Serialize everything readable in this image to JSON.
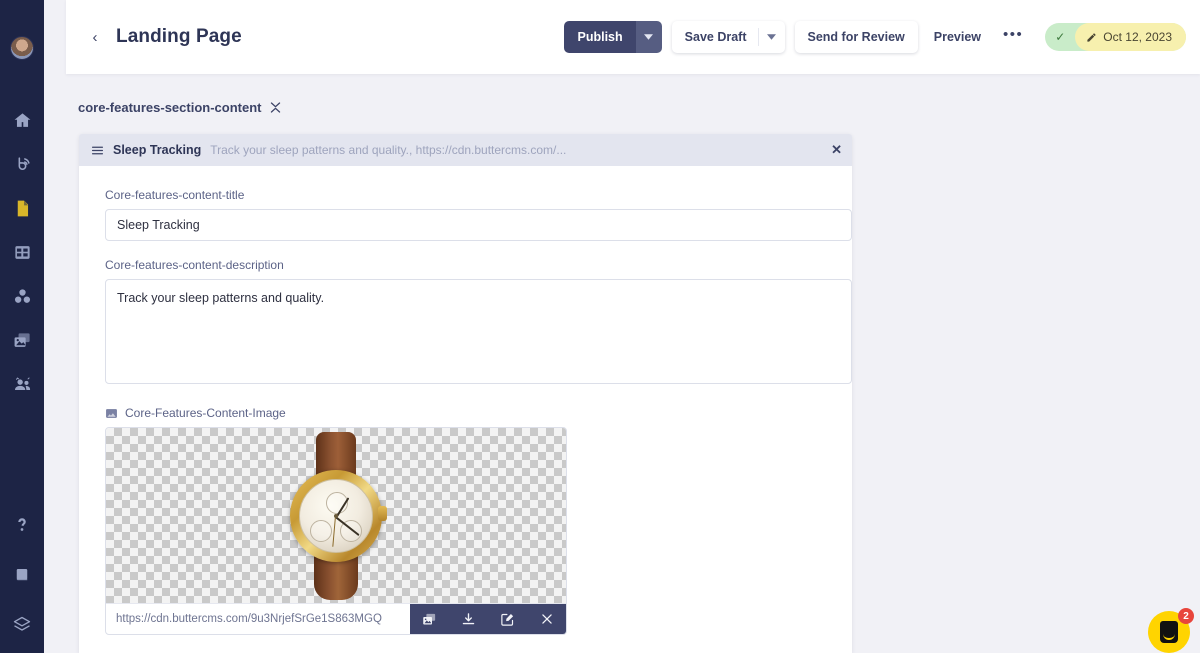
{
  "sidebar": {
    "avatar_name": "user-avatar",
    "nav": [
      {
        "name": "home",
        "label": "Home"
      },
      {
        "name": "blog",
        "label": "Blog"
      },
      {
        "name": "pages",
        "label": "Pages"
      },
      {
        "name": "collections",
        "label": "Collections"
      },
      {
        "name": "components",
        "label": "Components"
      },
      {
        "name": "media",
        "label": "Media"
      },
      {
        "name": "team",
        "label": "Team"
      }
    ],
    "bottom": [
      {
        "name": "help",
        "label": "Help"
      },
      {
        "name": "docs",
        "label": "Docs"
      },
      {
        "name": "layers",
        "label": "Layers"
      }
    ],
    "active_index": 2
  },
  "header": {
    "back_icon": "‹",
    "title": "Landing Page",
    "publish_label": "Publish",
    "save_draft_label": "Save Draft",
    "send_review_label": "Send for Review",
    "preview_label": "Preview",
    "more_label": "•••",
    "status_check": "✓",
    "status_date": "Oct 12, 2023"
  },
  "main": {
    "section_label": "core-features-section-content",
    "item": {
      "title": "Sleep Tracking",
      "subtitle": "Track your sleep patterns and quality., https://cdn.buttercms.com/...",
      "close_label": "✕"
    },
    "fields": {
      "title_label": "Core-features-content-title",
      "title_value": "Sleep Tracking",
      "title_placeholder": "",
      "description_label": "Core-features-content-description",
      "description_value": "Track your sleep patterns and quality.",
      "description_placeholder": "",
      "image_label": "Core-Features-Content-Image",
      "image_url": "https://cdn.buttercms.com/9u3NrjefSrGe1S863MGQ"
    },
    "image_actions": [
      {
        "name": "replace-image",
        "label": "Replace"
      },
      {
        "name": "download-image",
        "label": "Download"
      },
      {
        "name": "edit-image",
        "label": "Edit"
      },
      {
        "name": "remove-image",
        "label": "Remove"
      }
    ]
  },
  "chat": {
    "badge": "2"
  },
  "colors": {
    "sidebar": "#1d2445",
    "accent": "#3f456c",
    "active_nav": "#d8b62a",
    "status_green": "#c9ecc9",
    "status_yellow": "#f7f0ae",
    "chat_yellow": "#ffd400",
    "badge_red": "#e8453c",
    "page_bg": "#f1f1f6"
  }
}
